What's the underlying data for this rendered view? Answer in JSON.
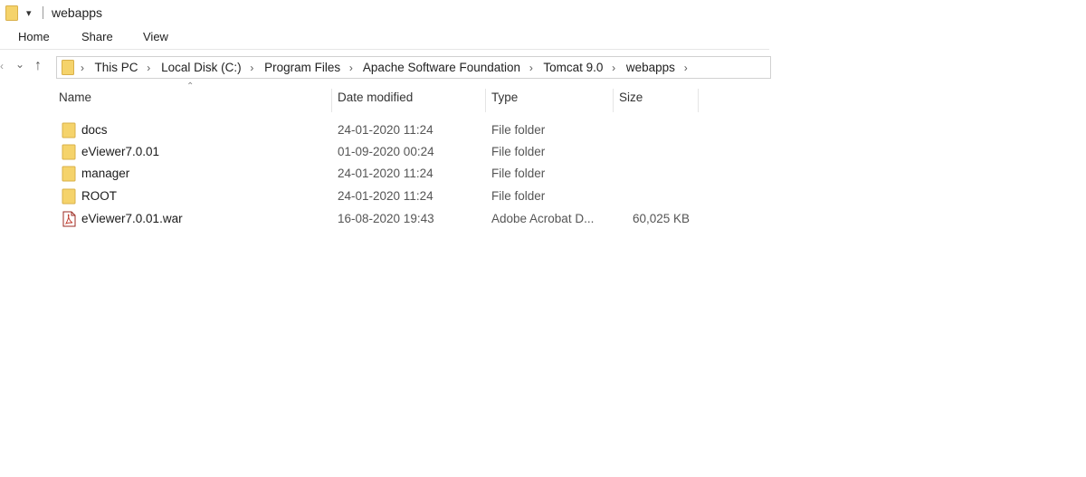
{
  "window": {
    "title": "webapps",
    "folder_icon": "folder-icon",
    "qa_toolbar_icon": "dropdown-arrow-icon"
  },
  "ribbon": {
    "tabs": [
      "Home",
      "Share",
      "View"
    ]
  },
  "nav": {
    "back_icon": "back-arrow-icon",
    "recent_icon": "chevron-down-icon",
    "up_icon": "up-arrow-icon"
  },
  "address": {
    "crumbs": [
      "This PC",
      "Local Disk (C:)",
      "Program Files",
      "Apache Software Foundation",
      "Tomcat 9.0",
      "webapps"
    ]
  },
  "columns": {
    "name": "Name",
    "date": "Date modified",
    "type": "Type",
    "size": "Size"
  },
  "files": [
    {
      "name": "docs",
      "date": "24-01-2020 11:24",
      "type": "File folder",
      "size": "",
      "icon": "folder-icon"
    },
    {
      "name": "eViewer7.0.01",
      "date": "01-09-2020 00:24",
      "type": "File folder",
      "size": "",
      "icon": "folder-icon"
    },
    {
      "name": "manager",
      "date": "24-01-2020 11:24",
      "type": "File folder",
      "size": "",
      "icon": "folder-icon"
    },
    {
      "name": "ROOT",
      "date": "24-01-2020 11:24",
      "type": "File folder",
      "size": "",
      "icon": "folder-icon"
    },
    {
      "name": "eViewer7.0.01.war",
      "date": "16-08-2020 19:43",
      "type": "Adobe Acrobat D...",
      "size": "60,025 KB",
      "icon": "acrobat-file-icon"
    }
  ],
  "colors": {
    "folder": "#F5D36B",
    "folder_tab": "#E8BE45",
    "pdf_accent": "#C0392B"
  }
}
